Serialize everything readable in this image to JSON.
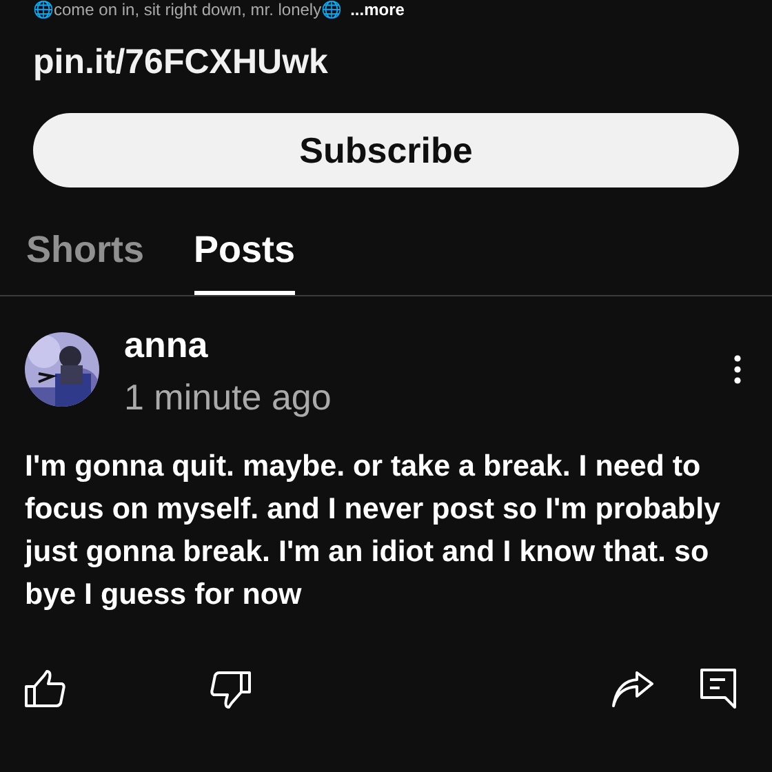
{
  "channel": {
    "description": "🌐come on in, sit right down, mr. lonely🌐",
    "more_link": "...more",
    "link": "pin.it/76FCXHUwk",
    "subscribe_button": "Subscribe"
  },
  "tabs": [
    {
      "label": "Shorts",
      "selected": false
    },
    {
      "label": "Posts",
      "selected": true
    }
  ],
  "post": {
    "author": "anna",
    "time": "1 minute ago",
    "text": "I'm gonna quit. maybe. or take a break. I need to focus on myself. and I never post so I'm probably just gonna break. I'm an idiot and I know that. so bye I guess for now"
  }
}
